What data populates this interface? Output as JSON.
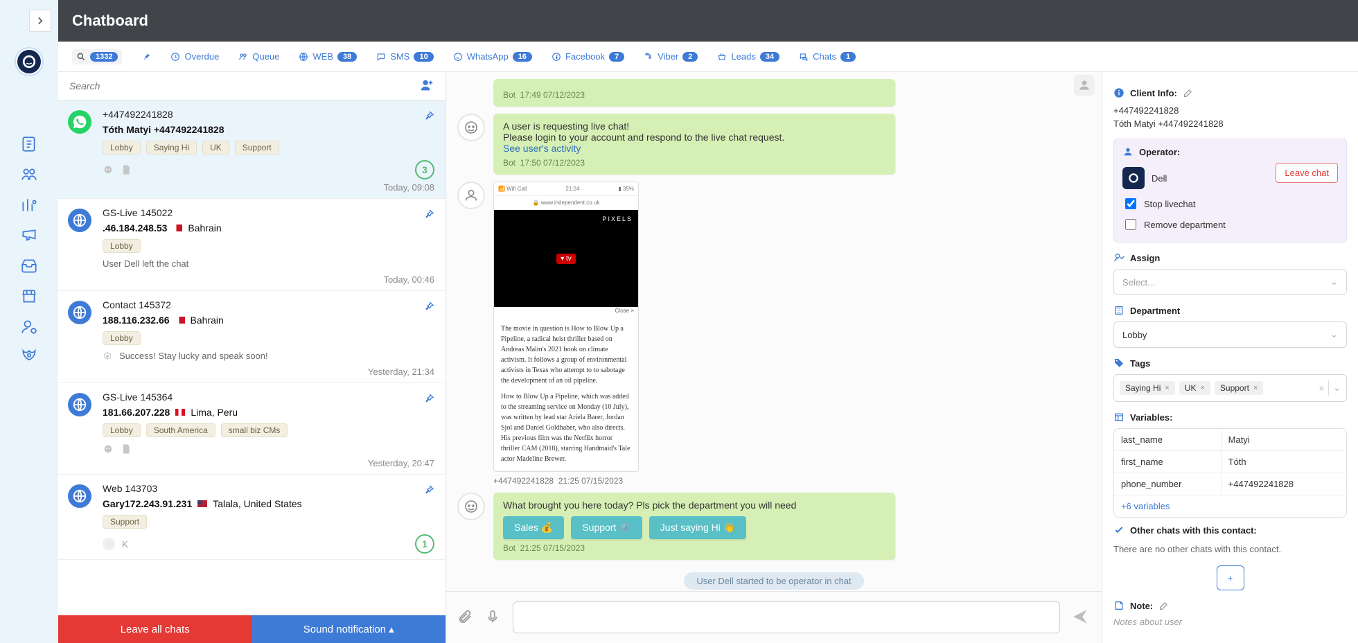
{
  "header": {
    "title": "Chatboard"
  },
  "tabs": {
    "search_badge": "1332",
    "overdue": "Overdue",
    "queue": "Queue",
    "web": "WEB",
    "web_badge": "38",
    "sms": "SMS",
    "sms_badge": "10",
    "whatsapp": "WhatsApp",
    "whatsapp_badge": "16",
    "facebook": "Facebook",
    "facebook_badge": "7",
    "viber": "Viber",
    "viber_badge": "2",
    "leads": "Leads",
    "leads_badge": "34",
    "chats": "Chats",
    "chats_badge": "1"
  },
  "search": {
    "placeholder": "Search"
  },
  "footer": {
    "leave": "Leave all chats",
    "sound": "Sound notification"
  },
  "conversations": [
    {
      "channel": "whatsapp",
      "title": "+447492241828",
      "subtitle_name": "Tóth Matyi +447492241828",
      "tags": [
        "Lobby",
        "Saying Hi",
        "UK",
        "Support"
      ],
      "timestamp": "Today, 09:08",
      "unread": "3",
      "active": true
    },
    {
      "channel": "web",
      "title": "GS-Live 145022",
      "subtitle_ip": ".46.184.248.53",
      "flag": "bh",
      "country": "Bahrain",
      "tags": [
        "Lobby"
      ],
      "event": "User Dell left the chat",
      "timestamp": "Today, 00:46"
    },
    {
      "channel": "web",
      "title": "Contact 145372",
      "subtitle_ip": "188.116.232.66",
      "flag": "bh",
      "country": "Bahrain",
      "tags": [
        "Lobby"
      ],
      "event_icon": "gear",
      "event": "Success! Stay lucky and speak soon!",
      "timestamp": "Yesterday, 21:34"
    },
    {
      "channel": "web",
      "title": "GS-Live 145364",
      "subtitle_ip": "181.66.207.228",
      "flag": "pe",
      "country": "Lima, Peru",
      "tags": [
        "Lobby",
        "South America",
        "small biz CMs"
      ],
      "timestamp": "Yesterday, 20:47",
      "show_file_icon": true
    },
    {
      "channel": "web",
      "title": "Web 143703",
      "subtitle_name_prefix": "Gary",
      "subtitle_ip": "172.243.91.231",
      "flag": "us",
      "country": "Talala, United States",
      "tags": [
        "Support"
      ],
      "initial_row": "K",
      "unread": "1"
    }
  ],
  "chat": {
    "messages": [
      {
        "kind": "bot_bubble_meta_only",
        "author": "Bot",
        "meta": "17:49 07/12/2023"
      },
      {
        "kind": "bot_bubble",
        "line1": "A user is requesting live chat!",
        "line2": "Please login to your account and respond to the live chat request.",
        "link": "See user's activity",
        "author": "Bot",
        "meta": "17:50 07/12/2023"
      },
      {
        "kind": "user_image",
        "img": {
          "bar_left": "Wifi Call",
          "bar_mid": "21:24",
          "bar_right": "35%",
          "url_label": "www.independent.co.uk",
          "overlay_brand": "PIXELS",
          "center_label": "tv",
          "close_label": "Close ×",
          "para1": "The movie in question is How to Blow Up a Pipeline, a radical heist thriller based on Andreas Malm's 2021 book on climate activism. It follows a group of environmental activists in Texas who attempt to to sabotage the development of an oil pipeline.",
          "para2": "How to Blow Up a Pipeline, which was added to the streaming service on Monday (10 July), was written by lead star Ariela Barer, Jordan Sjol and Daniel Goldhaber, who also directs. His previous film was the Netflix horror thriller CAM (2018), starring Handmaid's Tale actor Madeline Brewer."
        },
        "sender": "+447492241828",
        "meta": "21:25 07/15/2023"
      },
      {
        "kind": "bot_bubble_qr",
        "text": "What brought you here today? Pls pick the department you will need",
        "buttons": [
          "Sales 💰",
          "Support ⚙️",
          "Just saying Hi 👋"
        ],
        "author": "Bot",
        "meta": "21:25 07/15/2023"
      }
    ],
    "system_pill": "User Dell started to be operator in chat"
  },
  "right": {
    "client_info_label": "Client Info:",
    "client_phone": "+447492241828",
    "client_name": "Tóth Matyi +447492241828",
    "operator_label": "Operator:",
    "operator_name": "Dell",
    "stop_label": "Stop livechat",
    "remove_label": "Remove department",
    "leave_chat": "Leave chat",
    "assign_label": "Assign",
    "assign_placeholder": "Select...",
    "department_label": "Department",
    "department_value": "Lobby",
    "tags_label": "Tags",
    "tags": [
      "Saying Hi",
      "UK",
      "Support"
    ],
    "variables_label": "Variables:",
    "vars": [
      {
        "k": "last_name",
        "v": "Matyi"
      },
      {
        "k": "first_name",
        "v": "Tóth"
      },
      {
        "k": "phone_number",
        "v": "+447492241828"
      }
    ],
    "more_vars": "+6 variables",
    "other_chats_label": "Other chats with this contact:",
    "other_chats_text": "There are no other chats with this contact.",
    "note_label": "Note:",
    "note_placeholder": "Notes about user"
  }
}
